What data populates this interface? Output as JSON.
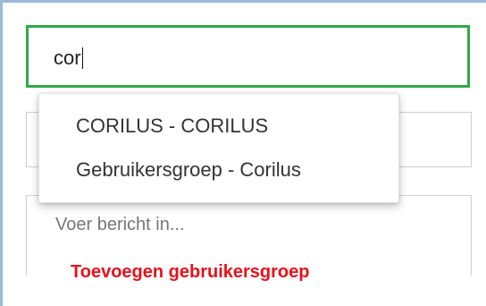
{
  "search": {
    "value": "cor"
  },
  "dropdown": {
    "items": [
      {
        "label": "CORILUS - CORILUS"
      },
      {
        "label": "Gebruikersgroep - Corilus"
      }
    ]
  },
  "message": {
    "placeholder": "Voer bericht in..."
  },
  "actions": {
    "add_group_label": "Toevoegen gebruikersgroep"
  },
  "colors": {
    "focus_border": "#2eaa4a",
    "link_red": "#e8111b",
    "frame_blue": "#9bbbd8"
  }
}
